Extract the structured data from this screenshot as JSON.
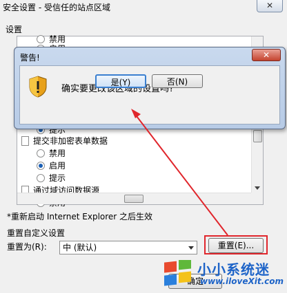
{
  "main_dialog": {
    "title": "安全设置 - 受信任的站点区域",
    "close": "✕",
    "settings_label": "设置",
    "tree": [
      {
        "kind": "radio",
        "label": "禁用",
        "checked": false
      },
      {
        "kind": "radio",
        "label": "启用",
        "checked": false
      },
      {
        "kind": "radio",
        "label": "提示",
        "checked": true
      },
      {
        "kind": "doc",
        "label": "提交非加密表单数据"
      },
      {
        "kind": "radio",
        "label": "禁用",
        "checked": false
      },
      {
        "kind": "radio",
        "label": "启用",
        "checked": true
      },
      {
        "kind": "radio",
        "label": "提示",
        "checked": false
      },
      {
        "kind": "doc",
        "label": "通过域访问数据源"
      },
      {
        "kind": "radio",
        "label": "禁用",
        "checked": false
      }
    ],
    "restart_note": "*重新启动 Internet Explorer 之后生效",
    "reset_group_title": "重置自定义设置",
    "reset_to_label": "重置为(R):",
    "reset_select_value": "中 (默认)",
    "reset_button": "重置(E)...",
    "bottom_button": "确定"
  },
  "warning_dialog": {
    "title": "警告!",
    "close": "✕",
    "message": "确实要更改该区域的设置吗?",
    "yes_button": "是(Y)",
    "no_button": "否(N)"
  },
  "watermark": {
    "name": "小小系统迷",
    "url": "www.iloveXit.com"
  },
  "colors": {
    "annotation_red": "#e0262c",
    "warning_frame": "#b7cbe6"
  }
}
